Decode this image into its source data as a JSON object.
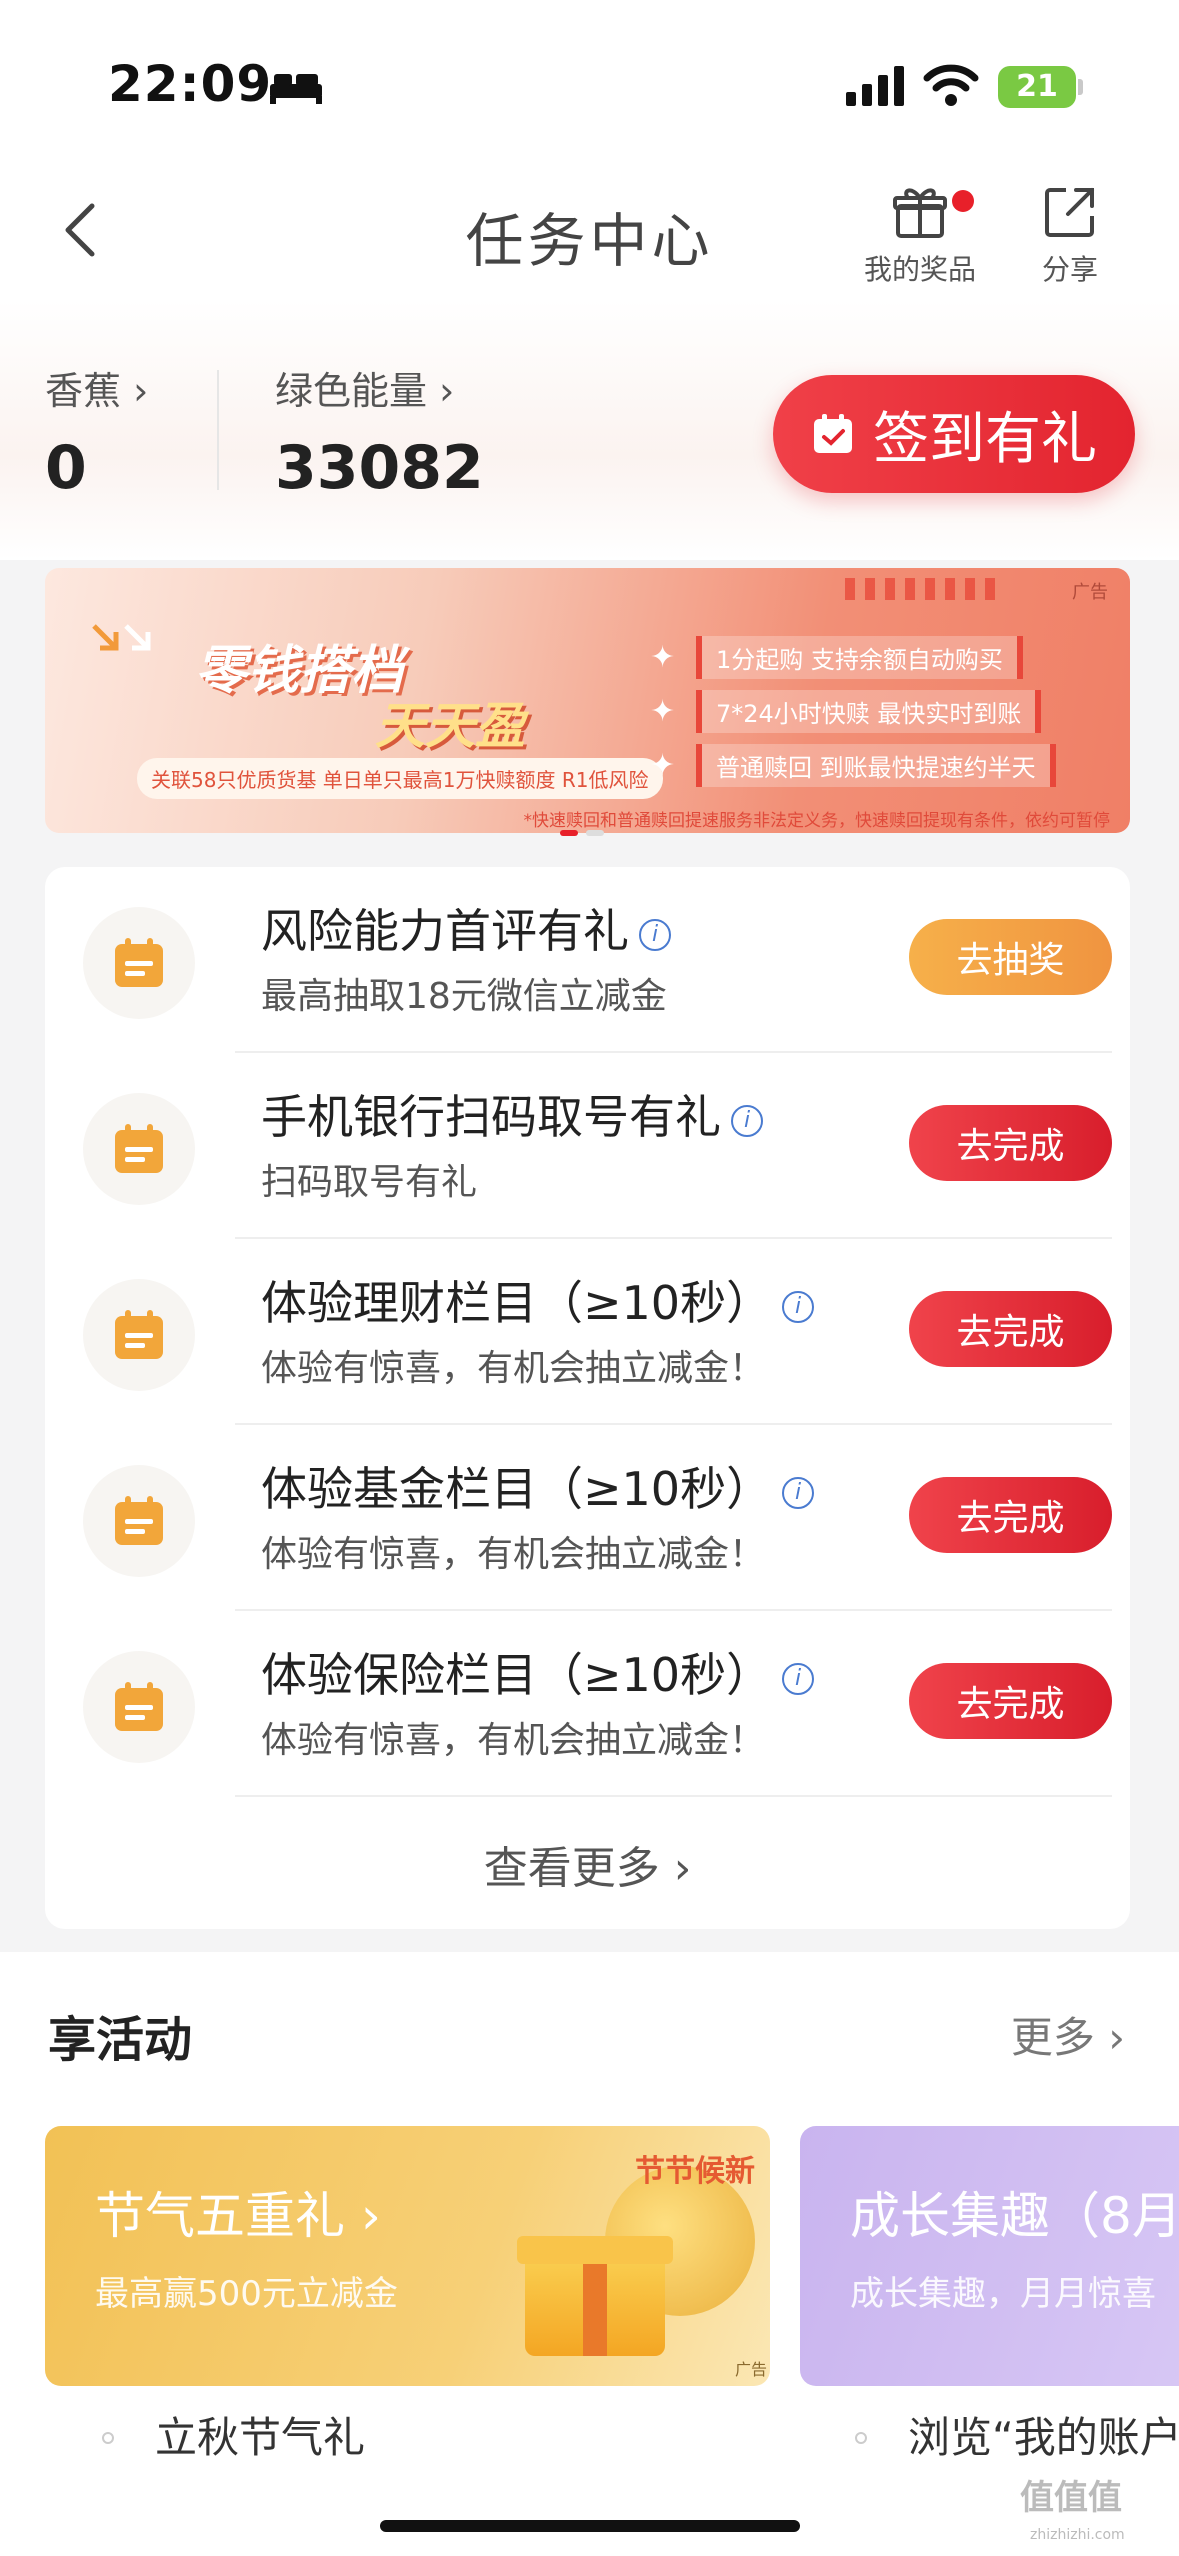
{
  "status_bar": {
    "time": "22:09",
    "battery": "21"
  },
  "nav": {
    "title": "任务中心",
    "prize_label": "我的奖品",
    "share_label": "分享"
  },
  "stats": [
    {
      "label": "香蕉 ›",
      "value": "0"
    },
    {
      "label": "绿色能量 ›",
      "value": "33082"
    }
  ],
  "checkin": {
    "label": "签到有礼"
  },
  "ad": {
    "tag": "广告",
    "headline": "零钱搭档",
    "headline2": "天天盈",
    "sub": "关联58只优质货基 单日单只最高1万快赎额度 R1低风险",
    "features": [
      "1分起购 支持余额自动购买",
      "7*24小时快赎 最快实时到账",
      "普通赎回 到账最快提速约半天"
    ],
    "footnote": "*快速赎回和普通赎回提速服务非法定义务，快速赎回提现有条件，依约可暂停"
  },
  "tasks": [
    {
      "title": "风险能力首评有礼",
      "desc": "最高抽取18元微信立减金",
      "button": "去抽奖",
      "style": "orange"
    },
    {
      "title": "手机银行扫码取号有礼",
      "desc": "扫码取号有礼",
      "button": "去完成",
      "style": "red"
    },
    {
      "title": "体验理财栏目（≥10秒）",
      "desc": "体验有惊喜，有机会抽立减金！",
      "button": "去完成",
      "style": "red"
    },
    {
      "title": "体验基金栏目（≥10秒）",
      "desc": "体验有惊喜，有机会抽立减金！",
      "button": "去完成",
      "style": "red"
    },
    {
      "title": "体验保险栏目（≥10秒）",
      "desc": "体验有惊喜，有机会抽立减金！",
      "button": "去完成",
      "style": "red"
    }
  ],
  "see_more": "查看更多 ›",
  "activities": {
    "title": "享活动",
    "more": "更多 ›",
    "cards": [
      {
        "title": "节气五重礼 ›",
        "sub": "最高赢500元立减金",
        "badge": "节节候新",
        "adtag": "广告",
        "item": "立秋节气礼"
      },
      {
        "title": "成长集趣（8月",
        "sub": "成长集趣，月月惊喜",
        "item": "浏览“我的账户"
      }
    ]
  },
  "watermark": {
    "text": "值值值",
    "sub": "zhizhizhi.com"
  }
}
